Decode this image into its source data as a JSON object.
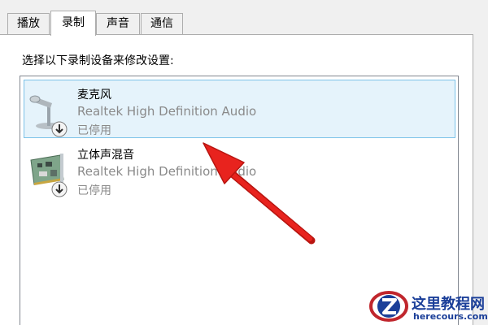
{
  "tabs": [
    {
      "label": "播放",
      "active": false
    },
    {
      "label": "录制",
      "active": true
    },
    {
      "label": "声音",
      "active": false
    },
    {
      "label": "通信",
      "active": false
    }
  ],
  "instruction": "选择以下录制设备来修改设置:",
  "devices": [
    {
      "name": "麦克风",
      "description": "Realtek High Definition Audio",
      "status": "已停用",
      "icon": "microphone-icon",
      "selected": true
    },
    {
      "name": "立体声混音",
      "description": "Realtek High Definition Audio",
      "status": "已停用",
      "icon": "sound-card-icon",
      "selected": false
    }
  ],
  "watermark": {
    "title": "这里教程网",
    "url": "herecours.com"
  },
  "colors": {
    "selection_bg": "#e5f3fb",
    "selection_border": "#7cc2e8",
    "arrow": "#e8231e",
    "watermark": "#1b3f99"
  }
}
